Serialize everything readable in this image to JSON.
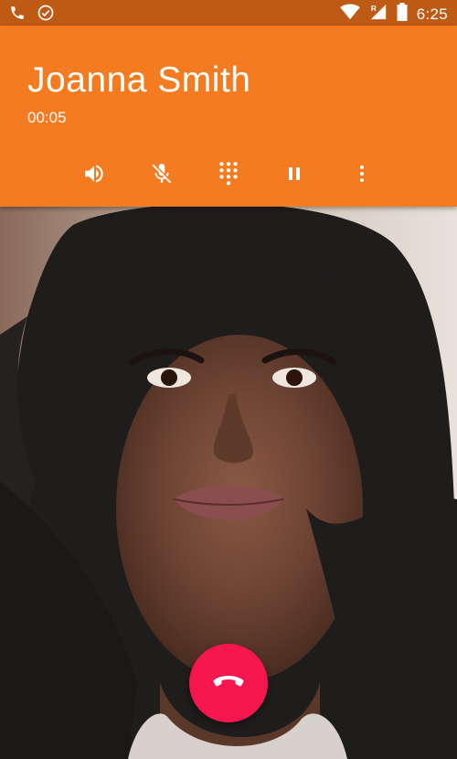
{
  "status_bar": {
    "time": "6:25",
    "left_icons": [
      "phone-icon",
      "check-circle-icon"
    ],
    "right_icons": [
      "wifi-icon",
      "signal-roaming-icon",
      "battery-icon"
    ]
  },
  "call": {
    "caller_name": "Joanna Smith",
    "duration": "00:05"
  },
  "actions": [
    {
      "icon": "speaker-icon"
    },
    {
      "icon": "mute-mic-icon"
    },
    {
      "icon": "dialpad-icon"
    },
    {
      "icon": "pause-icon"
    },
    {
      "icon": "more-vert-icon"
    }
  ],
  "colors": {
    "header": "#f47b20",
    "status_bar": "#bf5a15",
    "end_call": "#f5164e"
  }
}
